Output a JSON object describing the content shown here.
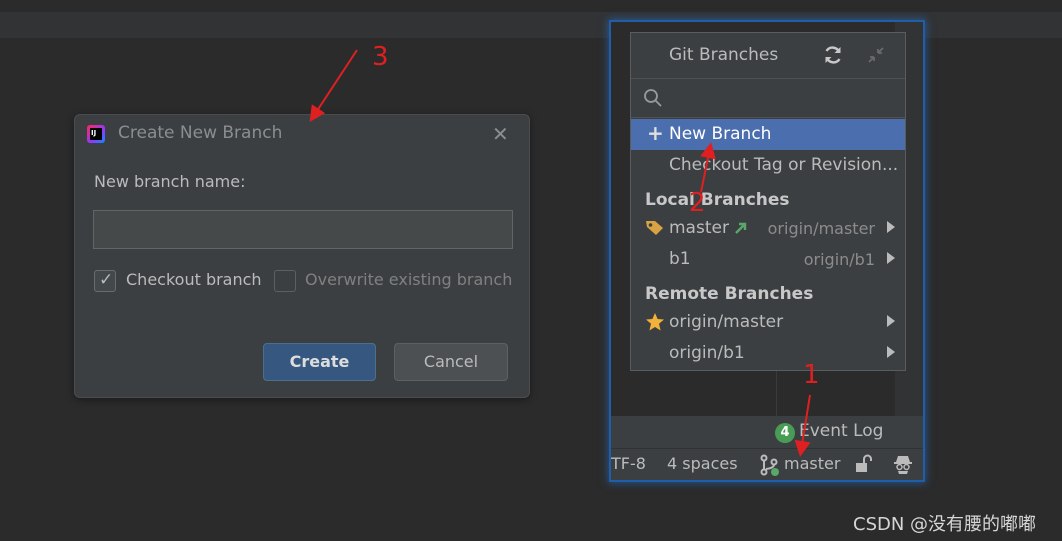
{
  "dialog": {
    "title": "Create New Branch",
    "logo_text": "IJ",
    "close_glyph": "✕",
    "name_label": "New branch name:",
    "name_value": "",
    "checkout_label": "Checkout branch",
    "checkout_checked": true,
    "overwrite_label": "Overwrite existing branch",
    "overwrite_checked": false,
    "create_label": "Create",
    "cancel_label": "Cancel"
  },
  "git_popup": {
    "title": "Git Branches",
    "search_placeholder": "",
    "new_branch": "New Branch",
    "checkout_tag": "Checkout Tag or Revision...",
    "local_header": "Local Branches",
    "local_branches": [
      {
        "name": "master",
        "remote": "origin/master"
      },
      {
        "name": "b1",
        "remote": "origin/b1"
      }
    ],
    "remote_header": "Remote Branches",
    "remote_branches": [
      {
        "name": "origin/master"
      },
      {
        "name": "origin/b1"
      }
    ]
  },
  "event_log": {
    "badge": "4",
    "label": "Event Log"
  },
  "status_bar": {
    "encoding": "TF-8",
    "indent": "4 spaces",
    "branch": "master"
  },
  "annotations": {
    "n1": "1",
    "n2": "2",
    "n3": "3"
  },
  "watermark": "CSDN @没有腰的嘟嘟",
  "colors": {
    "selection": "#4b6eaf",
    "annotation": "#e02020",
    "badge": "#499c54",
    "focus_glow": "#1e5fa8"
  }
}
